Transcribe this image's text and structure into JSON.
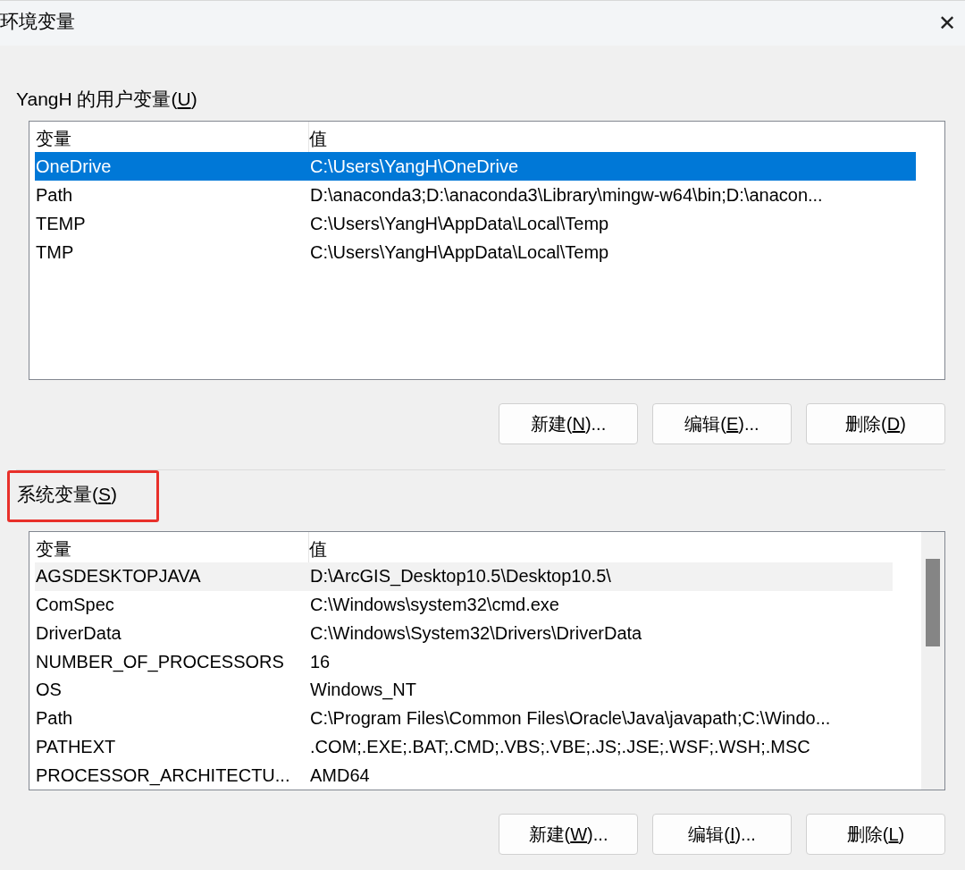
{
  "window": {
    "title": "环境变量",
    "close": "✕"
  },
  "sections": [
    {
      "title": {
        "pre": "YangH 的用户变量(",
        "key": "U",
        "post": ")"
      },
      "highlighted": false,
      "scrollbar": false,
      "columns": [
        "变量",
        "值"
      ],
      "rows": [
        {
          "name": "OneDrive",
          "value": "C:\\Users\\YangH\\OneDrive",
          "selected": true,
          "hovered": false
        },
        {
          "name": "Path",
          "value": "D:\\anaconda3;D:\\anaconda3\\Library\\mingw-w64\\bin;D:\\anacon...",
          "selected": false,
          "hovered": false
        },
        {
          "name": "TEMP",
          "value": "C:\\Users\\YangH\\AppData\\Local\\Temp",
          "selected": false,
          "hovered": false
        },
        {
          "name": "TMP",
          "value": "C:\\Users\\YangH\\AppData\\Local\\Temp",
          "selected": false,
          "hovered": false
        }
      ],
      "buttons": [
        {
          "pre": "新建(",
          "key": "N",
          "post": ")..."
        },
        {
          "pre": "编辑(",
          "key": "E",
          "post": ")..."
        },
        {
          "pre": "删除(",
          "key": "D",
          "post": ")"
        }
      ]
    },
    {
      "title": {
        "pre": "系统变量(",
        "key": "S",
        "post": ")"
      },
      "highlighted": true,
      "scrollbar": true,
      "columns": [
        "变量",
        "值"
      ],
      "rows": [
        {
          "name": "AGSDESKTOPJAVA",
          "value": "D:\\ArcGIS_Desktop10.5\\Desktop10.5\\",
          "selected": false,
          "hovered": true
        },
        {
          "name": "ComSpec",
          "value": "C:\\Windows\\system32\\cmd.exe",
          "selected": false,
          "hovered": false
        },
        {
          "name": "DriverData",
          "value": "C:\\Windows\\System32\\Drivers\\DriverData",
          "selected": false,
          "hovered": false
        },
        {
          "name": "NUMBER_OF_PROCESSORS",
          "value": "16",
          "selected": false,
          "hovered": false
        },
        {
          "name": "OS",
          "value": "Windows_NT",
          "selected": false,
          "hovered": false
        },
        {
          "name": "Path",
          "value": "C:\\Program Files\\Common Files\\Oracle\\Java\\javapath;C:\\Windo...",
          "selected": false,
          "hovered": false
        },
        {
          "name": "PATHEXT",
          "value": ".COM;.EXE;.BAT;.CMD;.VBS;.VBE;.JS;.JSE;.WSF;.WSH;.MSC",
          "selected": false,
          "hovered": false
        },
        {
          "name": "PROCESSOR_ARCHITECTU...",
          "value": "AMD64",
          "selected": false,
          "hovered": false
        }
      ],
      "buttons": [
        {
          "pre": "新建(",
          "key": "W",
          "post": ")..."
        },
        {
          "pre": "编辑(",
          "key": "I",
          "post": ")..."
        },
        {
          "pre": "删除(",
          "key": "L",
          "post": ")"
        }
      ]
    }
  ]
}
